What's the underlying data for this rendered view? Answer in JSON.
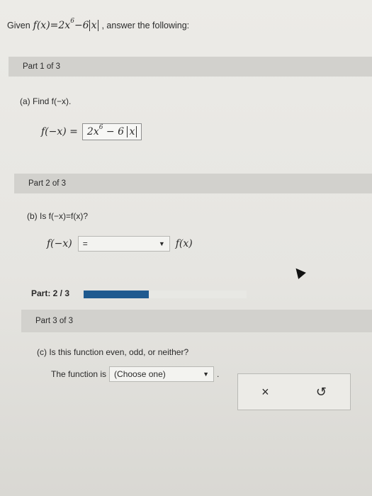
{
  "header": {
    "given_label": "Given",
    "function_expr": "f(x)=2x",
    "function_exp": "6",
    "function_tail": "−6",
    "abs_var": "x",
    "instruction": ", answer the following:"
  },
  "part1": {
    "title": "Part 1 of 3",
    "question": "(a) Find f(−x).",
    "lhs": "f(−x) =",
    "answer_main": "2x",
    "answer_exp": "6",
    "answer_tail": "− 6",
    "answer_abs": "x"
  },
  "part2": {
    "title": "Part 2 of 3",
    "question": "(b) Is f(−x)=f(x)?",
    "lhs": "f(−x)",
    "select_value": "=",
    "rhs": "f(x)"
  },
  "progress": {
    "label": "Part: 2 / 3",
    "fraction": 0.4
  },
  "part3": {
    "title": "Part 3 of 3",
    "question": "(c) Is this function even, odd, or neither?",
    "label": "The function is",
    "select_value": "(Choose one)",
    "punct": "."
  },
  "buttons": {
    "clear": "×",
    "reset": "↺"
  },
  "icons": {
    "dropdown": "chevron-down-icon",
    "cursor": "mouse-pointer-icon"
  }
}
